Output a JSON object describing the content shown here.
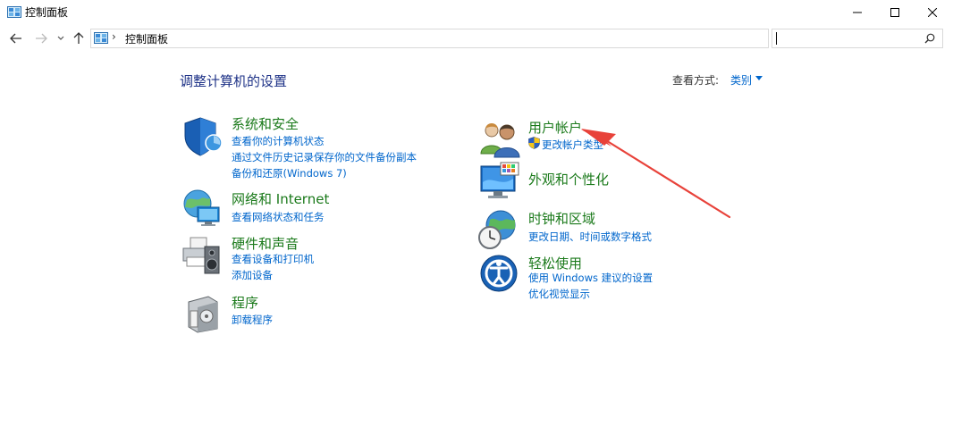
{
  "window": {
    "title": "控制面板"
  },
  "address": {
    "path": "控制面板",
    "separator": "›",
    "search_placeholder": ""
  },
  "content": {
    "heading": "调整计算机的设置",
    "view_by_label": "查看方式:",
    "view_by_value": "类别"
  },
  "categories": {
    "system": {
      "title": "系统和安全",
      "links": [
        "查看你的计算机状态",
        "通过文件历史记录保存你的文件备份副本",
        "备份和还原(Windows 7)"
      ]
    },
    "network": {
      "title": "网络和 Internet",
      "links": [
        "查看网络状态和任务"
      ]
    },
    "hardware": {
      "title": "硬件和声音",
      "links": [
        "查看设备和打印机",
        "添加设备"
      ]
    },
    "programs": {
      "title": "程序",
      "links": [
        "卸载程序"
      ]
    },
    "users": {
      "title": "用户帐户",
      "links": [
        "更改帐户类型"
      ]
    },
    "appearance": {
      "title": "外观和个性化",
      "links": []
    },
    "clock": {
      "title": "时钟和区域",
      "links": [
        "更改日期、时间或数字格式"
      ]
    },
    "ease": {
      "title": "轻松使用",
      "links": [
        "使用 Windows 建议的设置",
        "优化视觉显示"
      ]
    }
  },
  "colors": {
    "heading": "#1e3287",
    "category_title": "#1b7a1b",
    "link": "#0066cc",
    "annotation_arrow": "#e8423a"
  }
}
